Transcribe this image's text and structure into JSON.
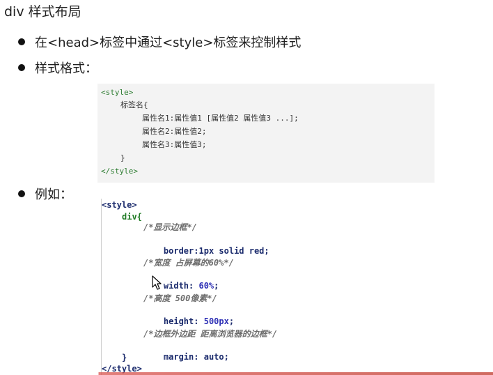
{
  "title": "div 样式布局",
  "bullets": [
    {
      "text": "在<head>标签中通过<style>标签来控制样式"
    },
    {
      "text": "样式格式："
    },
    {
      "text": "例如："
    }
  ],
  "format_code": {
    "open_tag": "<style>",
    "selector": "标签名{",
    "line1": "属性名1:属性值1 [属性值2 属性值3 ...];",
    "line2": "属性名2:属性值2;",
    "line3": "属性名3:属性值3;",
    "close_brace": "}",
    "close_tag": "</style>"
  },
  "example_code": {
    "open_tag": "<style>",
    "selector": "div{",
    "comment1": "/*显示边框*/",
    "prop1": "border",
    "val1": ":1px solid red;",
    "comment2": "/*宽度 占屏幕的60%*/",
    "prop2": "width",
    "val2_sep": ": ",
    "val2_num": "60%",
    "val2_end": ";",
    "comment3": "/*高度 500像素*/",
    "prop3": "height",
    "val3_sep": ": ",
    "val3_num": "500px",
    "val3_end": ";",
    "comment4": "/*边框外边距 距离浏览器的边框*/",
    "prop4": "margin",
    "val4": ": auto;",
    "close_brace": "}",
    "close_tag": "</style>"
  },
  "colors": {
    "code_tag": "#2e7d32",
    "keyword": "#1a2a6c",
    "number": "#2d2fb5",
    "comment": "#6e6e6e"
  },
  "icons": {
    "bullet": "bullet-dot-icon",
    "cursor": "text-cursor-icon"
  }
}
